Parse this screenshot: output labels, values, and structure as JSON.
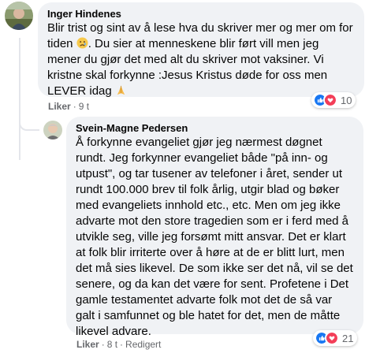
{
  "comments": [
    {
      "author": "Inger Hindenes",
      "text_before_emoji": "Blir trist og sint av å lese hva du skriver mer og mer om for tiden ",
      "text_after_emoji": ". Du sier at menneskene blir ført vill men jeg mener du gjør det med alt du skriver mot vaksiner. Vi kristne skal forkynne :Jesus Kristus døde for oss men LEVER idag ",
      "emoji_1": "sad-face-emoji",
      "emoji_2": "praying-hands-emoji",
      "like_label": "Liker",
      "time": "9 t",
      "reaction_count": "10",
      "reactions": [
        "like",
        "love"
      ]
    },
    {
      "author": "Svein-Magne Pedersen",
      "text": "Å forkynne evangeliet gjør jeg nærmest døgnet rundt. Jeg forkynner evangeliet både \"på inn- og utpust\", og tar tusener av telefoner i året, sender ut rundt 100.000 brev til folk årlig, utgir blad og bøker med evangeliets innhold etc., etc. Men om jeg ikke advarte mot den store tragedien som er i ferd med å utvikle seg, ville jeg forsømt mitt ansvar. Det er klart at folk blir irriterte over å høre at de er blitt lurt, men det må sies likevel. De som ikke ser det nå, vil se det senere, og da kan det være for sent. Profetene i Det gamle testamentet advarte folk mot det de så var galt i samfunnet og ble hatet for det, men de måtte likevel advare.",
      "like_label": "Liker",
      "time": "8 t",
      "edited_label": "Redigert",
      "reaction_count": "21",
      "reactions": [
        "like",
        "love"
      ]
    }
  ],
  "colors": {
    "bubble": "#f0f2f5",
    "meta_text": "#65676b",
    "like_blue": "#1877f2",
    "love_red": "#f33e58"
  }
}
